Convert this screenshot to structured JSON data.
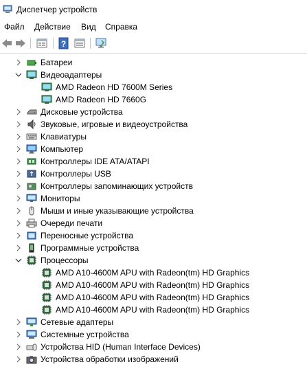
{
  "window": {
    "title": "Диспетчер устройств"
  },
  "menu": {
    "items": [
      {
        "label": "Файл"
      },
      {
        "label": "Действие"
      },
      {
        "label": "Вид"
      },
      {
        "label": "Справка"
      }
    ]
  },
  "toolbar": {
    "buttons": [
      {
        "icon": "back-arrow-icon"
      },
      {
        "icon": "forward-arrow-icon"
      },
      {
        "icon": "properties-icon"
      },
      {
        "icon": "help-icon"
      },
      {
        "icon": "view-icon"
      },
      {
        "icon": "scan-hardware-monitor-icon"
      }
    ]
  },
  "tree": {
    "items": [
      {
        "label": "Батареи",
        "level": 0,
        "expanded": false,
        "icon": "battery-icon"
      },
      {
        "label": "Видеоадаптеры",
        "level": 0,
        "expanded": true,
        "icon": "display-adapter-icon"
      },
      {
        "label": "AMD Radeon HD 7600M Series",
        "level": 1,
        "icon": "display-adapter-icon"
      },
      {
        "label": "AMD Radeon HD 7660G",
        "level": 1,
        "icon": "display-adapter-icon"
      },
      {
        "label": "Дисковые устройства",
        "level": 0,
        "expanded": false,
        "icon": "disk-drive-icon"
      },
      {
        "label": "Звуковые, игровые и видеоустройства",
        "level": 0,
        "expanded": false,
        "icon": "speaker-icon"
      },
      {
        "label": "Клавиатуры",
        "level": 0,
        "expanded": false,
        "icon": "keyboard-icon"
      },
      {
        "label": "Компьютер",
        "level": 0,
        "expanded": false,
        "icon": "computer-icon"
      },
      {
        "label": "Контроллеры IDE ATA/ATAPI",
        "level": 0,
        "expanded": false,
        "icon": "ide-controller-icon"
      },
      {
        "label": "Контроллеры USB",
        "level": 0,
        "expanded": false,
        "icon": "usb-icon"
      },
      {
        "label": "Контроллеры запоминающих устройств",
        "level": 0,
        "expanded": false,
        "icon": "storage-controller-icon"
      },
      {
        "label": "Мониторы",
        "level": 0,
        "expanded": false,
        "icon": "monitor-icon"
      },
      {
        "label": "Мыши и иные указывающие устройства",
        "level": 0,
        "expanded": false,
        "icon": "mouse-icon"
      },
      {
        "label": "Очереди печати",
        "level": 0,
        "expanded": false,
        "icon": "printer-icon"
      },
      {
        "label": "Переносные устройства",
        "level": 0,
        "expanded": false,
        "icon": "portable-device-icon"
      },
      {
        "label": "Программные устройства",
        "level": 0,
        "expanded": false,
        "icon": "software-device-icon"
      },
      {
        "label": "Процессоры",
        "level": 0,
        "expanded": true,
        "icon": "processor-icon"
      },
      {
        "label": "AMD A10-4600M APU with Radeon(tm) HD Graphics",
        "level": 1,
        "icon": "processor-icon"
      },
      {
        "label": "AMD A10-4600M APU with Radeon(tm) HD Graphics",
        "level": 1,
        "icon": "processor-icon"
      },
      {
        "label": "AMD A10-4600M APU with Radeon(tm) HD Graphics",
        "level": 1,
        "icon": "processor-icon"
      },
      {
        "label": "AMD A10-4600M APU with Radeon(tm) HD Graphics",
        "level": 1,
        "icon": "processor-icon"
      },
      {
        "label": "Сетевые адаптеры",
        "level": 0,
        "expanded": false,
        "icon": "network-adapter-icon"
      },
      {
        "label": "Системные устройства",
        "level": 0,
        "expanded": false,
        "icon": "system-device-icon"
      },
      {
        "label": "Устройства HID (Human Interface Devices)",
        "level": 0,
        "expanded": false,
        "icon": "hid-icon"
      },
      {
        "label": "Устройства обработки изображений",
        "level": 0,
        "expanded": false,
        "icon": "camera-icon"
      }
    ]
  }
}
